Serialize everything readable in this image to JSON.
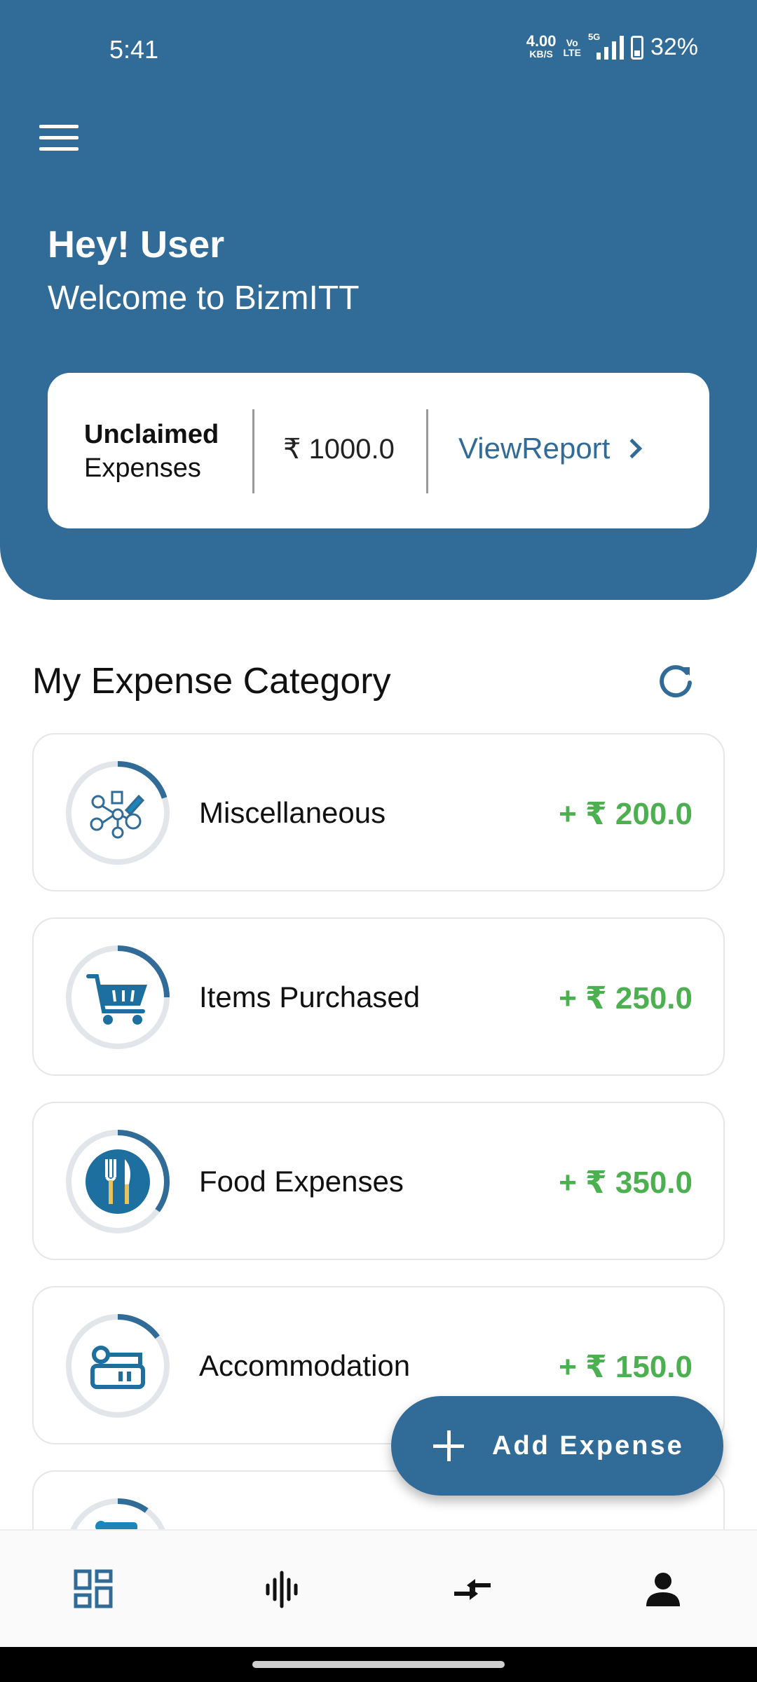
{
  "status_bar": {
    "time": "5:41",
    "speed_value": "4.00",
    "speed_unit": "KB/S",
    "volte_top": "Vo",
    "volte_bottom": "LTE",
    "network": "5G",
    "battery": "32%"
  },
  "header": {
    "greeting": "Hey! User",
    "welcome": "Welcome to BizmITT"
  },
  "summary": {
    "label_bold": "Unclaimed",
    "label": "Expenses",
    "amount": "₹ 1000.0",
    "view_report": "ViewReport"
  },
  "section": {
    "title": "My Expense Category"
  },
  "categories": [
    {
      "name": "Miscellaneous",
      "amount": "+ ₹ 200.0",
      "progress": 0.2,
      "icon": "miscellaneous-icon"
    },
    {
      "name": "Items Purchased",
      "amount": "+ ₹ 250.0",
      "progress": 0.25,
      "icon": "shopping-cart-icon"
    },
    {
      "name": "Food Expenses",
      "amount": "+ ₹ 350.0",
      "progress": 0.35,
      "icon": "fork-knife-icon"
    },
    {
      "name": "Accommodation",
      "amount": "+ ₹ 150.0",
      "progress": 0.15,
      "icon": "bed-icon"
    },
    {
      "name": "",
      "amount": "",
      "progress": 0.1,
      "icon": "travel-icon"
    }
  ],
  "fab": {
    "label": "Add Expense"
  },
  "bottom_nav": [
    "dashboard-icon",
    "audio-wave-icon",
    "transfer-icon",
    "profile-icon"
  ],
  "colors": {
    "primary": "#316b98",
    "amount_green": "#4caf50",
    "ring_track": "#e2e6ea"
  }
}
